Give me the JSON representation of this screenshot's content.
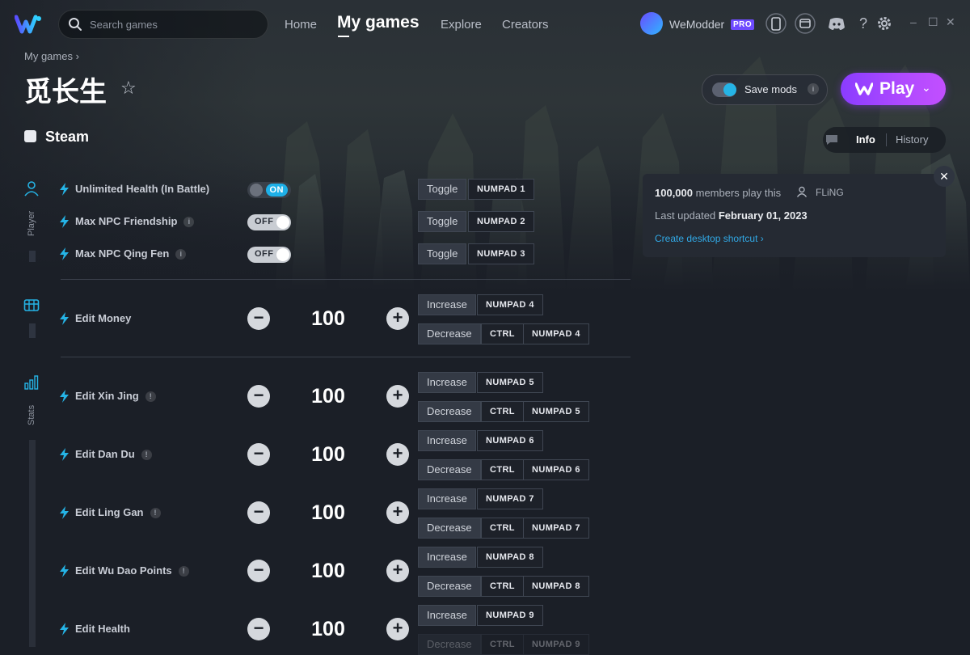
{
  "app": {
    "search_placeholder": "Search games",
    "nav": {
      "home": "Home",
      "my_games": "My games",
      "explore": "Explore",
      "creators": "Creators"
    },
    "user": {
      "name": "WeModder",
      "badge": "PRO"
    },
    "window_controls": {
      "minimize": "–",
      "maximize": "☐",
      "close": "✕"
    }
  },
  "header": {
    "breadcrumb": "My games ›",
    "title": "觅长生",
    "platform": "Steam",
    "save_mods": "Save mods",
    "play": "Play",
    "tabs": {
      "info": "Info",
      "history": "History"
    }
  },
  "info_panel": {
    "members_count": "100,000",
    "members_suffix": "members play this",
    "author": "FLiNG",
    "updated_prefix": "Last updated",
    "updated_date": "February 01, 2023",
    "shortcut_link": "Create desktop shortcut ›"
  },
  "sidebar": {
    "player": "Player",
    "stats": "Stats"
  },
  "mods": {
    "unlimited_health": {
      "name": "Unlimited Health (In Battle)",
      "state": "ON",
      "action": "Toggle",
      "key": "NUMPAD 1"
    },
    "max_npc_friendship": {
      "name": "Max NPC Friendship",
      "state": "OFF",
      "action": "Toggle",
      "key": "NUMPAD 2"
    },
    "max_npc_qing_fen": {
      "name": "Max NPC Qing Fen",
      "state": "OFF",
      "action": "Toggle",
      "key": "NUMPAD 3"
    },
    "edit_money": {
      "name": "Edit Money",
      "value": "100",
      "inc": "Increase",
      "inc_key": "NUMPAD 4",
      "dec": "Decrease",
      "ctrl": "CTRL",
      "dec_key": "NUMPAD 4"
    },
    "edit_xin_jing": {
      "name": "Edit Xin Jing",
      "value": "100",
      "inc": "Increase",
      "inc_key": "NUMPAD 5",
      "dec": "Decrease",
      "ctrl": "CTRL",
      "dec_key": "NUMPAD 5"
    },
    "edit_dan_du": {
      "name": "Edit Dan Du",
      "value": "100",
      "inc": "Increase",
      "inc_key": "NUMPAD 6",
      "dec": "Decrease",
      "ctrl": "CTRL",
      "dec_key": "NUMPAD 6"
    },
    "edit_ling_gan": {
      "name": "Edit Ling Gan",
      "value": "100",
      "inc": "Increase",
      "inc_key": "NUMPAD 7",
      "dec": "Decrease",
      "ctrl": "CTRL",
      "dec_key": "NUMPAD 7"
    },
    "edit_wu_dao": {
      "name": "Edit Wu Dao Points",
      "value": "100",
      "inc": "Increase",
      "inc_key": "NUMPAD 8",
      "dec": "Decrease",
      "ctrl": "CTRL",
      "dec_key": "NUMPAD 8"
    },
    "edit_health": {
      "name": "Edit Health",
      "value": "100",
      "inc": "Increase",
      "inc_key": "NUMPAD 9",
      "dec": "Decrease",
      "ctrl": "CTRL",
      "dec_key": "NUMPAD 9"
    }
  },
  "colors": {
    "accent": "#1eb0e8",
    "play_gradient_start": "#8a3cff",
    "play_gradient_end": "#c24fff",
    "background": "#1b1f27"
  }
}
